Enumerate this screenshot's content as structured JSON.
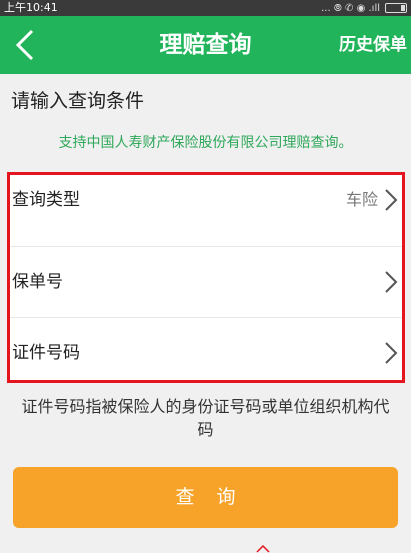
{
  "status_bar": {
    "time": "上午10:41",
    "indicators": "... ⦾ ✆ ◉ .ıll"
  },
  "nav": {
    "title": "理赔查询",
    "back_icon": "chevron-left-icon",
    "history_label": "历史保单"
  },
  "section": {
    "title": "请输入查询条件",
    "subtitle": "支持中国人寿财产保险股份有限公司理赔查询。"
  },
  "form": {
    "rows": [
      {
        "label": "查询类型",
        "value": "车险"
      },
      {
        "label": "保单号",
        "value": ""
      },
      {
        "label": "证件号码",
        "value": ""
      }
    ]
  },
  "hint": "证件号码指被保险人的身份证号码或单位组织机构代码",
  "query_button": {
    "label": "查询"
  },
  "colors": {
    "nav_green": "#22b45a",
    "subtitle_green": "#2fa85a",
    "button_orange": "#f7a32a",
    "highlight_red": "#e4151f"
  }
}
